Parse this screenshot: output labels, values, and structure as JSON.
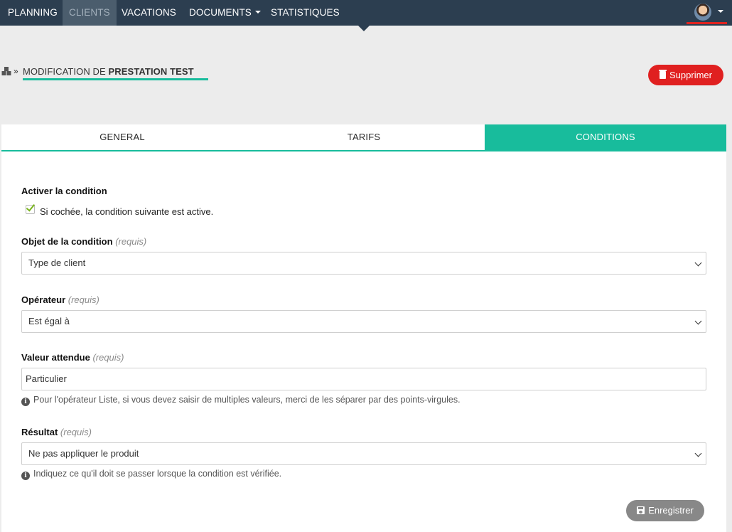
{
  "nav": {
    "items": [
      {
        "label": "PLANNING",
        "active": false,
        "dropdown": false
      },
      {
        "label": "CLIENTS",
        "active": true,
        "dropdown": false
      },
      {
        "label": "VACATIONS",
        "active": false,
        "dropdown": false
      },
      {
        "label": "DOCUMENTS",
        "active": false,
        "dropdown": true
      },
      {
        "label": "STATISTIQUES",
        "active": false,
        "dropdown": false
      }
    ],
    "background": "#2c3e50",
    "active_background": "#4b5d6d",
    "user_indicator_color": "#e0231f"
  },
  "breadcrumb": {
    "icon": "cubes-icon",
    "separator": "»",
    "prefix": "MODIFICATION DE",
    "name": "PRESTATION TEST"
  },
  "actions": {
    "delete_label": "Supprimer",
    "delete_icon": "trash-icon",
    "delete_color": "#e02020",
    "save_label": "Enregistrer",
    "save_icon": "save-icon"
  },
  "tabs": [
    {
      "label": "GENERAL",
      "active": false
    },
    {
      "label": "TARIFS",
      "active": false
    },
    {
      "label": "CONDITIONS",
      "active": true
    }
  ],
  "accent_color": "#18bc9c",
  "form": {
    "activate": {
      "label": "Activer la condition",
      "checkbox_text": "Si cochée, la condition suivante est active.",
      "checked": true
    },
    "object": {
      "label": "Objet de la condition",
      "required": "(requis)",
      "value": "Type de client"
    },
    "operator": {
      "label": "Opérateur",
      "required": "(requis)",
      "value": "Est égal à"
    },
    "expected": {
      "label": "Valeur attendue",
      "required": "(requis)",
      "value": "Particulier",
      "help": "Pour l'opérateur Liste, si vous devez saisir de multiples valeurs, merci de les séparer par des points-virgules."
    },
    "result": {
      "label": "Résultat",
      "required": "(requis)",
      "value": "Ne pas appliquer le produit",
      "help": "Indiquez ce qu'il doit se passer lorsque la condition est vérifiée."
    }
  }
}
